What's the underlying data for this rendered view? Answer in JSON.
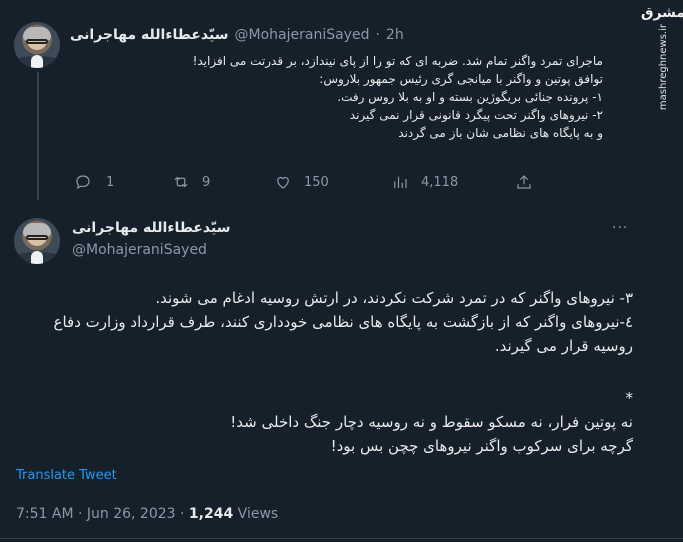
{
  "tweet1": {
    "display_name": "سیّدعطاءالله مهاجرانی",
    "handle": "@MohajeraniSayed",
    "separator": "·",
    "time": "2h",
    "lines": [
      "ماجرای تمرد واگنر تمام شد. ضربه ای که تو را از پای نیندازد، بر قدرتت می افزاید!",
      "توافق پوتین و واگنر با میانجی گری رئیس جمهور بلاروس:",
      "۱- پرونده جنائی بریگوژین بسته و او به بلا روس رفت.",
      "۲- نیروهای واگنر تحت پیگرد قانونی قرار نمی گیرند",
      "و به پایگاه های نظامی شان باز می گردند"
    ],
    "actions": {
      "replies": "1",
      "retweets": "9",
      "likes": "150",
      "views": "4,118"
    }
  },
  "tweet2": {
    "display_name": "سیّدعطاءالله مهاجرانی",
    "handle": "@MohajeraniSayed",
    "more": "···",
    "paragraphs": [
      "۳- نیروهای واگنر که در تمرد شرکت نکردند، در ارتش روسیه ادغام می شوند.",
      "٤-نیروهای واگنر که از بازگشت به پایگاه های نظامی خودداری کنند، طرف قرارداد وزارت دفاع روسیه قرار می گیرند."
    ],
    "star": "*",
    "closing": [
      "نه پوتین فرار، نه مسکو سقوط  و نه روسیه دچار جنگ داخلی شد!",
      "گرچه برای سرکوب واگنر نیروهای چچن بس بود!"
    ],
    "translate": "Translate Tweet",
    "timestamp": "7:51 AM · Jun 26, 2023 ·",
    "views_count": "1,244",
    "views_label": "Views"
  },
  "watermark": {
    "logo": "مشرق",
    "url": "mashreghnews.ir"
  },
  "colors": {
    "background": "#15202b",
    "text": "#e7e9ea",
    "muted": "#8b98a5",
    "link": "#1d9bf0",
    "divider": "#38444d"
  }
}
